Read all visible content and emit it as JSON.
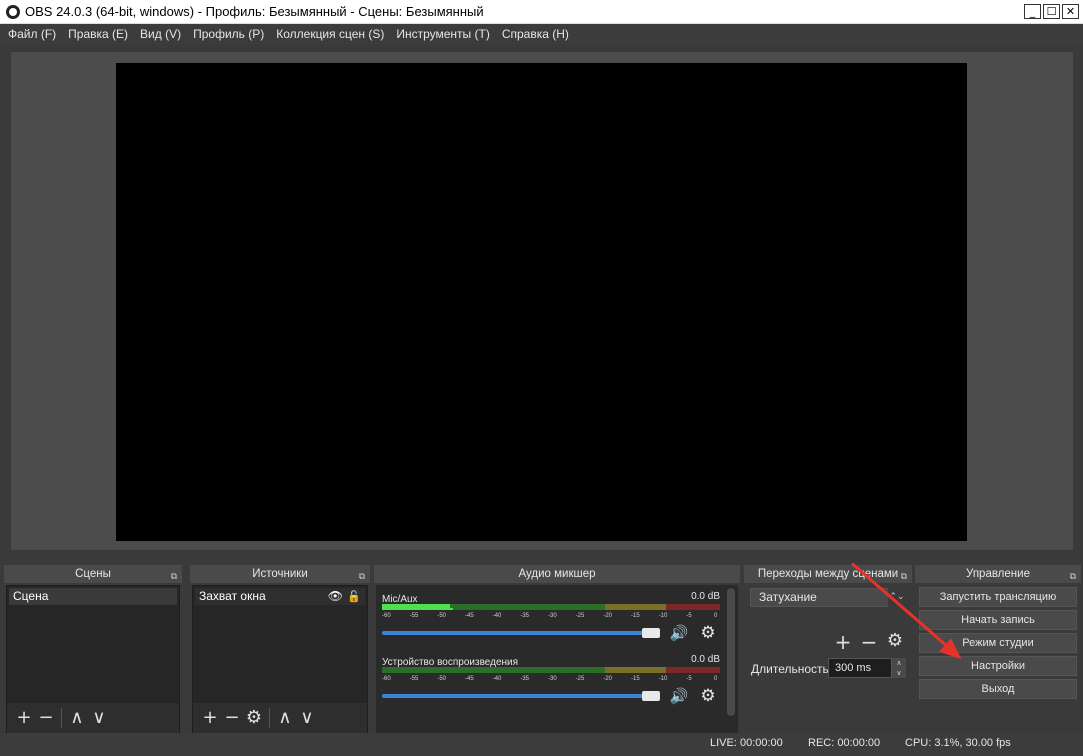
{
  "window": {
    "title": "OBS 24.0.3 (64-bit, windows) - Профиль: Безымянный - Сцены: Безымянный",
    "minimize": "_",
    "maximize": "☐",
    "close": "✕"
  },
  "menu": [
    "Файл (F)",
    "Правка (E)",
    "Вид (V)",
    "Профиль (P)",
    "Коллекция сцен (S)",
    "Инструменты (T)",
    "Справка (H)"
  ],
  "docks": {
    "scenes": {
      "title": "Сцены",
      "items": [
        "Сцена"
      ]
    },
    "sources": {
      "title": "Источники",
      "items": [
        "Захват окна"
      ]
    },
    "mixer": {
      "title": "Аудио микшер",
      "channels": [
        {
          "name": "Mic/Aux",
          "db": "0.0 dB",
          "level": 0.2,
          "peak": 0.21
        },
        {
          "name": "Устройство воспроизведения",
          "db": "0.0 dB",
          "level": 0,
          "peak": 0
        }
      ],
      "scale": [
        "-60",
        "-55",
        "-50",
        "-45",
        "-40",
        "-35",
        "-30",
        "-25",
        "-20",
        "-15",
        "-10",
        "-5",
        "0"
      ]
    },
    "transitions": {
      "title": "Переходы между сценами",
      "selected": "Затухание",
      "duration_label": "Длительность",
      "duration_value": "300 ms"
    },
    "controls": {
      "title": "Управление",
      "buttons": [
        "Запустить трансляцию",
        "Начать запись",
        "Режим студии",
        "Настройки",
        "Выход"
      ]
    }
  },
  "status": {
    "live": "LIVE: 00:00:00",
    "rec": "REC: 00:00:00",
    "cpu": "CPU: 3.1%, 30.00 fps"
  },
  "icons": {
    "float": "⧉",
    "plus": "+",
    "minus": "−",
    "up": "∧",
    "down": "∨",
    "gear": "⚙",
    "eye": "👁",
    "lock": "🔓",
    "speaker": "🔊",
    "chevrons": "⌃⌄"
  },
  "colors": {
    "accent_slider": "#3a87d8",
    "annotation_arrow": "#e5332a"
  }
}
